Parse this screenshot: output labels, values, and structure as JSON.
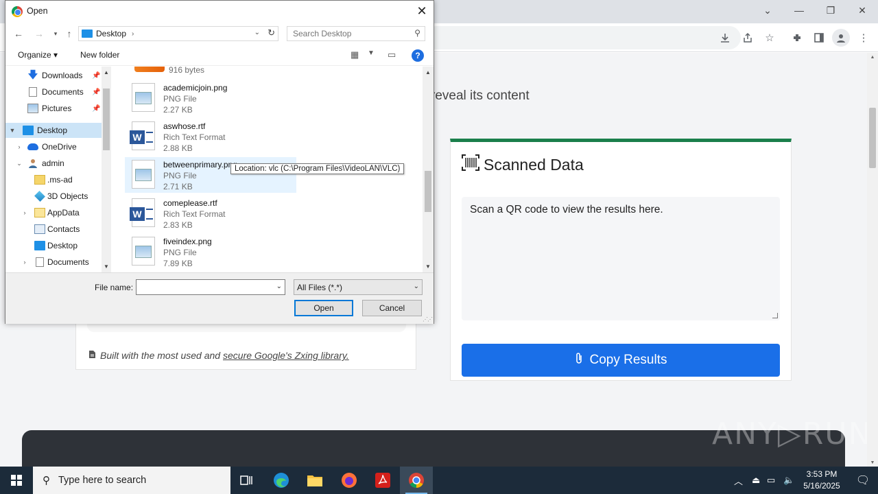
{
  "browser": {
    "window_controls": {
      "dropdown": "⌄",
      "minimize": "—",
      "restore": "❐",
      "close": "✕"
    },
    "toolbar_icons": [
      "download-icon",
      "share-icon",
      "star-icon",
      "extensions-icon",
      "sidepanel-icon",
      "profile-icon"
    ]
  },
  "page": {
    "reveal_text": "reveal its content",
    "built_with_prefix": "Built with the most used and ",
    "built_with_link": "secure Google's Zxing library.",
    "scanned_title": "Scanned Data",
    "scan_placeholder": "Scan a QR code to view the results here.",
    "copy_button": "Copy Results",
    "watermark": "ANY▷RUN"
  },
  "dialog": {
    "title": "Open",
    "breadcrumb": "Desktop",
    "search_placeholder": "Search Desktop",
    "organize": "Organize ▾",
    "new_folder": "New folder",
    "nav_items": [
      {
        "label": "Downloads",
        "pinned": true
      },
      {
        "label": "Documents",
        "pinned": true
      },
      {
        "label": "Pictures",
        "pinned": true
      },
      {
        "label": "Desktop",
        "selected": true
      },
      {
        "label": "OneDrive"
      },
      {
        "label": "admin"
      },
      {
        "label": ".ms-ad"
      },
      {
        "label": "3D Objects"
      },
      {
        "label": "AppData"
      },
      {
        "label": "Contacts"
      },
      {
        "label": "Desktop"
      },
      {
        "label": "Documents"
      }
    ],
    "partial_top_size": "916 bytes",
    "files": [
      {
        "name": "academicjoin.png",
        "type": "PNG File",
        "size": "2.27 KB",
        "kind": "png"
      },
      {
        "name": "aswhose.rtf",
        "type": "Rich Text Format",
        "size": "2.88 KB",
        "kind": "rtf"
      },
      {
        "name": "betweenprimary.png",
        "type": "PNG File",
        "size": "2.71 KB",
        "kind": "png"
      },
      {
        "name": "comeplease.rtf",
        "type": "Rich Text Format",
        "size": "2.83 KB",
        "kind": "rtf"
      },
      {
        "name": "fiveindex.png",
        "type": "PNG File",
        "size": "7.89 KB",
        "kind": "png"
      }
    ],
    "tooltip": "Location: vlc (C:\\Program Files\\VideoLAN\\VLC)",
    "file_name_label": "File name:",
    "file_name_value": "",
    "file_type": "All Files (*.*)",
    "open_button": "Open",
    "cancel_button": "Cancel"
  },
  "taskbar": {
    "search_placeholder": "Type here to search",
    "time": "3:53 PM",
    "date": "5/16/2025"
  }
}
